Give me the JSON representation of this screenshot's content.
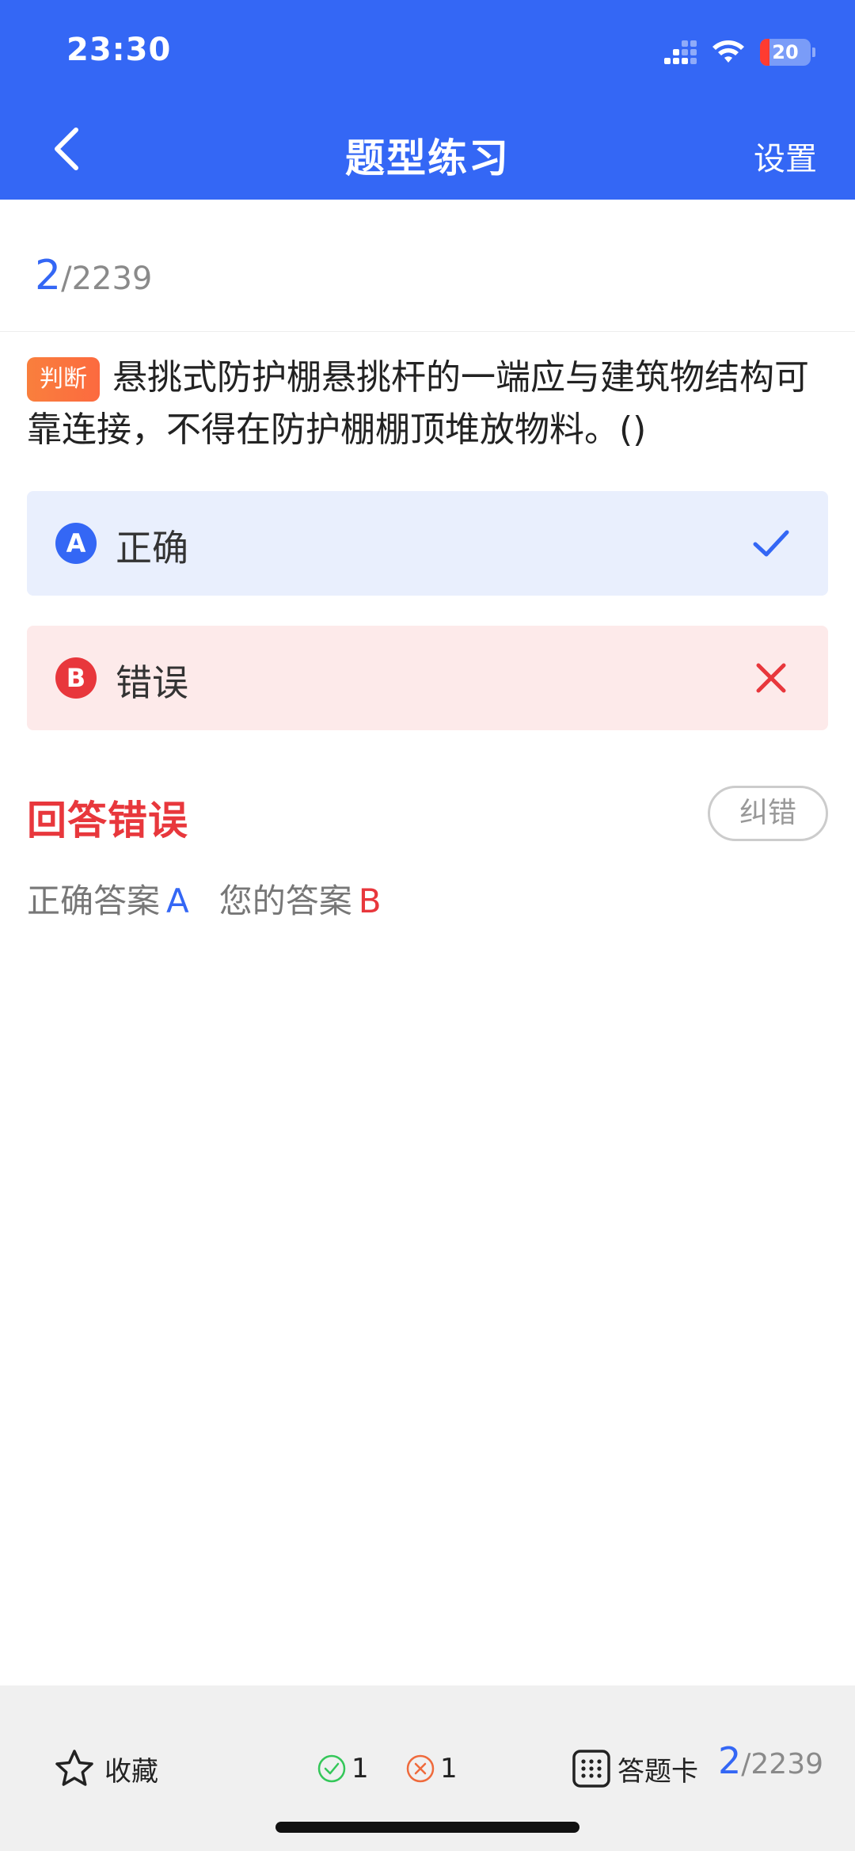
{
  "status": {
    "time": "23:30",
    "battery": "20"
  },
  "nav": {
    "title": "题型练习",
    "settings": "设置"
  },
  "progress": {
    "current": "2",
    "total": "/2239"
  },
  "question": {
    "type": "判断",
    "text": "悬挑式防护棚悬挑杆的一端应与建筑物结构可靠连接，不得在防护棚棚顶堆放物料。()"
  },
  "options": [
    {
      "letter": "A",
      "text": "正确",
      "state": "correct"
    },
    {
      "letter": "B",
      "text": "错误",
      "state": "wrong"
    }
  ],
  "result": {
    "title": "回答错误",
    "correction_button": "纠错",
    "correct_label": "正确答案",
    "correct_value": "A",
    "user_label": "您的答案",
    "user_value": "B"
  },
  "bottom": {
    "favorite": "收藏",
    "correct_count": "1",
    "wrong_count": "1",
    "answer_card": "答题卡",
    "current": "2",
    "total": "/2239"
  },
  "colors": {
    "primary": "#3467f5",
    "error": "#e8373c",
    "success": "#34c759",
    "badge": "#fc6a3f"
  }
}
